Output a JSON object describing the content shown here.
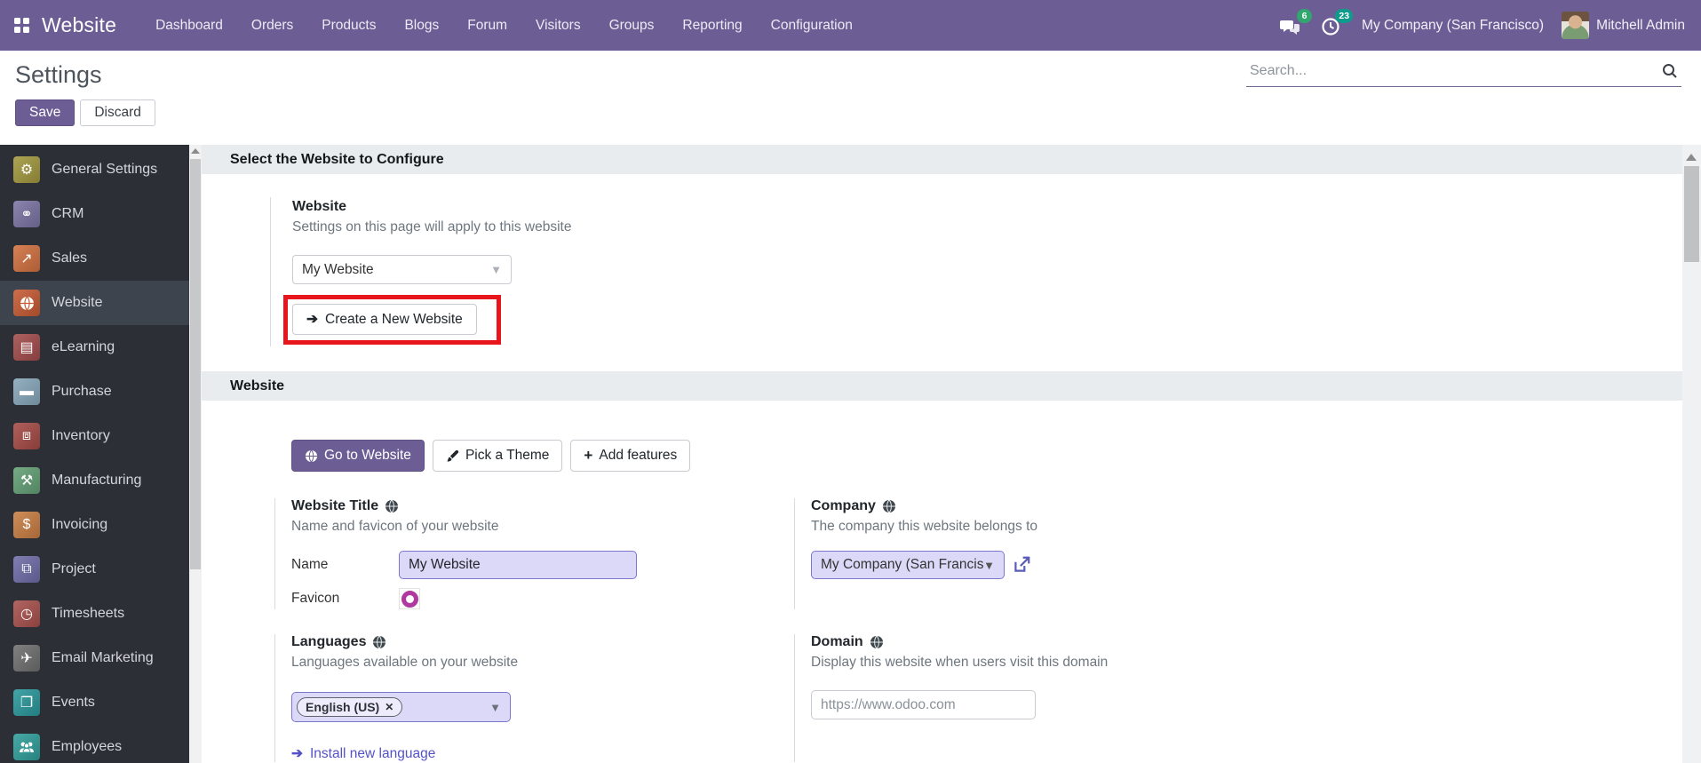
{
  "navbar": {
    "brand": "Website",
    "menus": [
      "Dashboard",
      "Orders",
      "Products",
      "Blogs",
      "Forum",
      "Visitors",
      "Groups",
      "Reporting",
      "Configuration"
    ],
    "messages_badge": "6",
    "activity_badge": "23",
    "company": "My Company (San Francisco)",
    "user": "Mitchell Admin",
    "colors": {
      "bg": "#6d5d95",
      "messages_badge": "#31a66f",
      "activity_badge": "#0f9b8c"
    }
  },
  "controlbar": {
    "title": "Settings",
    "save": "Save",
    "discard": "Discard",
    "search_placeholder": "Search..."
  },
  "sidebar": {
    "items": [
      {
        "label": "General Settings",
        "icon": "gear-icon",
        "glyph": "⚙",
        "color": "#a2983d"
      },
      {
        "label": "CRM",
        "icon": "handshake-icon",
        "glyph": "⚭",
        "color": "#7b74a4"
      },
      {
        "label": "Sales",
        "icon": "sales-chart-icon",
        "glyph": "↗",
        "color": "#d2703f"
      },
      {
        "label": "Website",
        "icon": "globe-icon",
        "glyph": "",
        "color": "#c65a33",
        "selected": true
      },
      {
        "label": "eLearning",
        "icon": "presentation-icon",
        "glyph": "▤",
        "color": "#a34b4b"
      },
      {
        "label": "Purchase",
        "icon": "credit-card-icon",
        "glyph": "▬",
        "color": "#87a7ba"
      },
      {
        "label": "Inventory",
        "icon": "box-icon",
        "glyph": "⧈",
        "color": "#a54a45"
      },
      {
        "label": "Manufacturing",
        "icon": "wrench-icon",
        "glyph": "⚒",
        "color": "#63a075"
      },
      {
        "label": "Invoicing",
        "icon": "invoice-icon",
        "glyph": "$",
        "color": "#c97e42"
      },
      {
        "label": "Project",
        "icon": "puzzle-icon",
        "glyph": "⧉",
        "color": "#6f6ca8"
      },
      {
        "label": "Timesheets",
        "icon": "stopwatch-icon",
        "glyph": "◷",
        "color": "#a8504c"
      },
      {
        "label": "Email Marketing",
        "icon": "paper-plane-icon",
        "glyph": "✈",
        "color": "#6f6f6f"
      },
      {
        "label": "Events",
        "icon": "ticket-icon",
        "glyph": "❐",
        "color": "#29989b"
      },
      {
        "label": "Employees",
        "icon": "people-icon",
        "glyph": "",
        "color": "#2f9e9a"
      }
    ]
  },
  "content": {
    "section1": {
      "title": "Select the Website to Configure",
      "website_box": {
        "label": "Website",
        "desc": "Settings on this page will apply to this website",
        "select_value": "My Website",
        "create_button": "Create a New Website",
        "arrow_glyph": "➔"
      }
    },
    "section2": {
      "title": "Website",
      "actions": {
        "go_to_website": "Go to Website",
        "pick_theme": "Pick a Theme",
        "add_features": "Add features",
        "plus_glyph": "+"
      },
      "website_title": {
        "label": "Website Title",
        "desc": "Name and favicon of your website",
        "name_label": "Name",
        "name_value": "My Website",
        "favicon_label": "Favicon"
      },
      "company": {
        "label": "Company",
        "desc": "The company this website belongs to",
        "select_value": "My Company (San Francisc"
      },
      "languages": {
        "label": "Languages",
        "desc": "Languages available on your website",
        "tag": "English (US)",
        "tag_remove": "✕",
        "install_link": "Install new language",
        "arrow_glyph": "➔"
      },
      "domain": {
        "label": "Domain",
        "desc": "Display this website when users visit this domain",
        "placeholder": "https://www.odoo.com"
      }
    },
    "colors": {
      "annotation_red": "#e9151c",
      "accent": "#6d5d95",
      "lavender_bg": "#dcd9f8",
      "lavender_border": "#7b77cf",
      "link": "#5452c6",
      "favicon_ring": "#b0399f"
    }
  }
}
